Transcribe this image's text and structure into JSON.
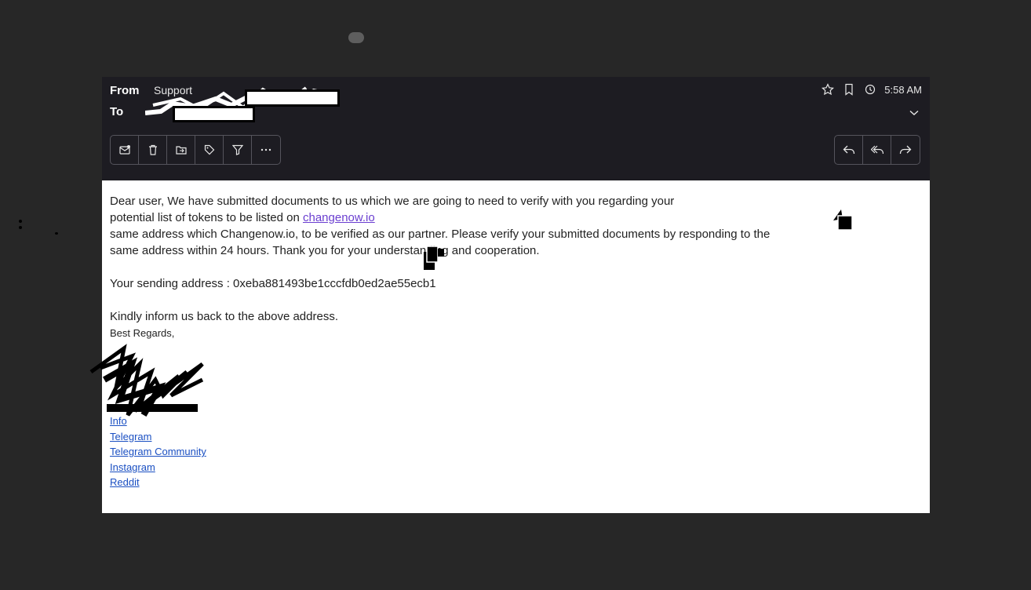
{
  "header": {
    "from_label": "From",
    "from_value": "Support",
    "to_label": "To",
    "time": "5:58 AM"
  },
  "icons": {
    "star": "star-icon",
    "bookmark": "bookmark-icon",
    "clock": "clock-icon",
    "expand": "chevron-down-icon"
  },
  "toolbar_left": [
    "mark-unread-icon",
    "trash-icon",
    "move-icon",
    "tag-icon",
    "filter-icon",
    "more-icon"
  ],
  "toolbar_right": [
    "reply-icon",
    "reply-all-icon",
    "forward-icon"
  ],
  "body": {
    "line1": "Dear user, We have submitted documents to us which we are going to need to verify with you regarding your",
    "line2_pre": "potential list of tokens to be listed on ",
    "line2_link": "changenow.io",
    "line3_pre": "same address which ",
    "line3_mid": "Changenow.io",
    "line3_post": ", to be verified as our partner. Please verify your submitted documents by responding to the",
    "line4": "same address within 24 hours. Thank you for your understanding and cooperation.",
    "address": "Your sending address : 0xeba881493be1cccfdb0ed2ae55ecb1",
    "closing": "Kindly inform us back to the above address.",
    "regards": "Best Regards,"
  },
  "footer_links": [
    "Info",
    "Telegram",
    "Telegram Community",
    "Instagram",
    "Reddit"
  ],
  "colors": {
    "header_bg": "#1d1c22",
    "page_bg": "#272727",
    "link": "#1a4fc2",
    "inline_link": "#6a3ed0"
  }
}
